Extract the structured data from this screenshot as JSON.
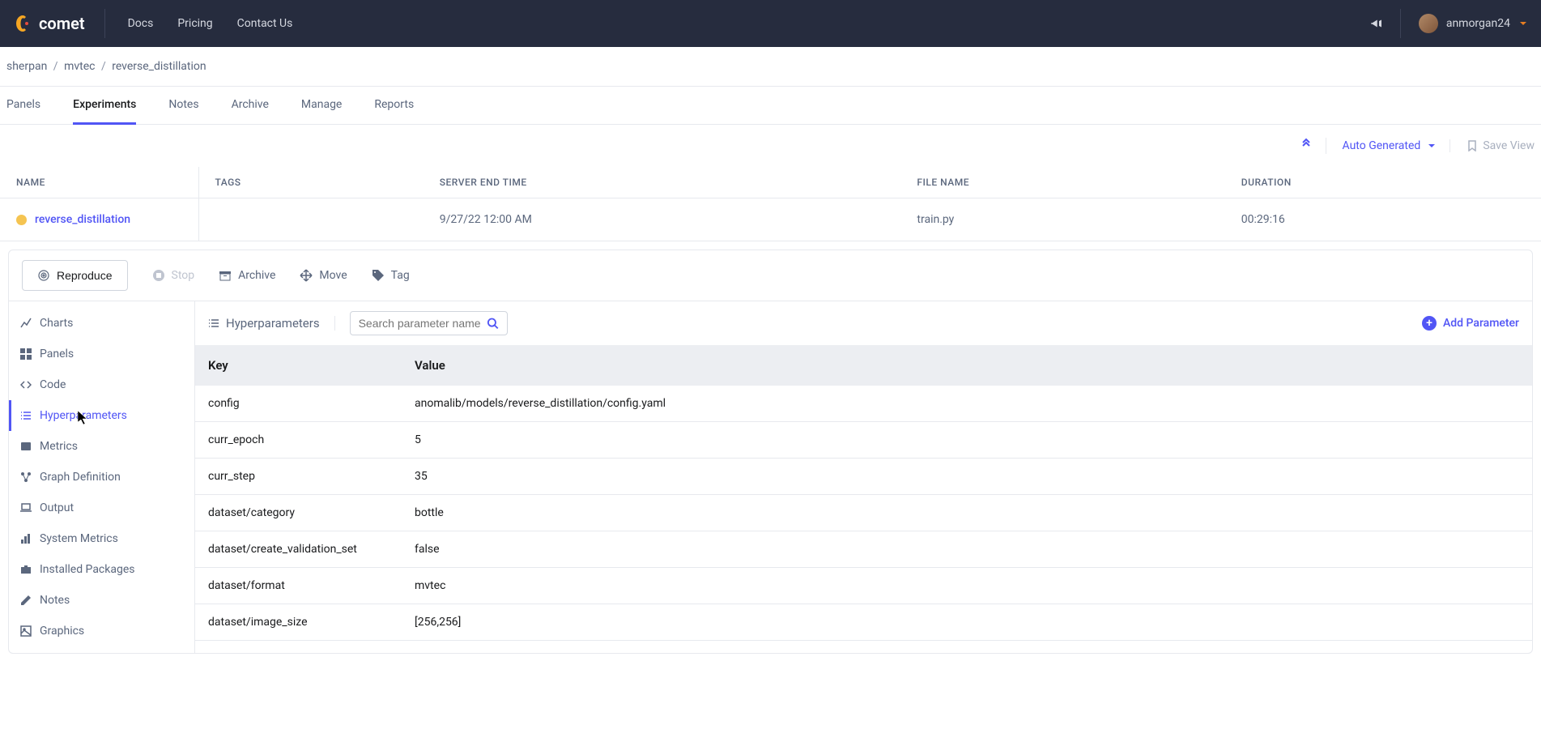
{
  "header": {
    "brand": "comet",
    "nav": {
      "docs": "Docs",
      "pricing": "Pricing",
      "contact": "Contact Us"
    },
    "username": "anmorgan24"
  },
  "breadcrumb": {
    "org": "sherpan",
    "project": "mvtec",
    "experiment": "reverse_distillation"
  },
  "tabs": [
    "Panels",
    "Experiments",
    "Notes",
    "Archive",
    "Manage",
    "Reports"
  ],
  "viewbar": {
    "autogen": "Auto Generated",
    "save": "Save View"
  },
  "exp_table": {
    "headers": {
      "name": "NAME",
      "tags": "TAGS",
      "end": "SERVER END TIME",
      "file": "FILE NAME",
      "duration": "DURATION"
    },
    "row": {
      "name": "reverse_distillation",
      "tags": "",
      "end": "9/27/22 12:00 AM",
      "file": "train.py",
      "duration": "00:29:16"
    }
  },
  "actions": {
    "reproduce": "Reproduce",
    "stop": "Stop",
    "archive": "Archive",
    "move": "Move",
    "tag": "Tag"
  },
  "sidebar": {
    "charts": "Charts",
    "panels": "Panels",
    "code": "Code",
    "hyperparams": "Hyperparameters",
    "metrics": "Metrics",
    "graphdef": "Graph Definition",
    "output": "Output",
    "sysmetrics": "System Metrics",
    "packages": "Installed Packages",
    "notes": "Notes",
    "graphics": "Graphics"
  },
  "section": {
    "title": "Hyperparameters",
    "search_placeholder": "Search parameter name",
    "add": "Add Parameter"
  },
  "params": {
    "headers": {
      "key": "Key",
      "value": "Value"
    },
    "rows": [
      {
        "k": "config",
        "v": "anomalib/models/reverse_distillation/config.yaml"
      },
      {
        "k": "curr_epoch",
        "v": "5"
      },
      {
        "k": "curr_step",
        "v": "35"
      },
      {
        "k": "dataset/category",
        "v": "bottle"
      },
      {
        "k": "dataset/create_validation_set",
        "v": "false"
      },
      {
        "k": "dataset/format",
        "v": "mvtec"
      },
      {
        "k": "dataset/image_size",
        "v": "[256,256]"
      }
    ]
  }
}
